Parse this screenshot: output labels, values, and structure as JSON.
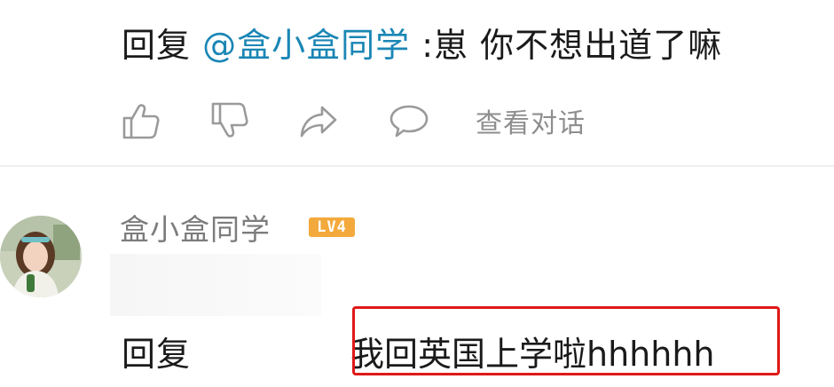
{
  "reply_top": {
    "prefix": "回复 ",
    "mention": "@盒小盒同学",
    "text": " :崽 你不想出道了嘛"
  },
  "actions": {
    "like_icon": "thumbs-up-icon",
    "dislike_icon": "thumbs-down-icon",
    "share_icon": "share-arrow-icon",
    "comment_icon": "comment-bubble-icon",
    "view_conversation": "查看对话"
  },
  "comment": {
    "username": "盒小盒同学",
    "level": "LV4",
    "reply_prefix": "回复",
    "reply_text": "我回英国上学啦hhhhhh"
  },
  "colors": {
    "mention": "#1a86b5",
    "level_badge": "#f3a93b",
    "highlight_box": "#e01818",
    "muted_text": "#8e8e8e"
  }
}
